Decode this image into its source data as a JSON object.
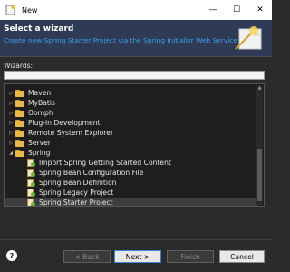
{
  "window": {
    "title": "New"
  },
  "header": {
    "title": "Select a wizard",
    "description": "Create new Spring Starter Project via the Spring Initializr Web Service"
  },
  "wizards_label": "Wizards:",
  "filter": {
    "value": ""
  },
  "tree": {
    "items": [
      {
        "label": "Maven",
        "type": "folder",
        "expanded": false
      },
      {
        "label": "MyBatis",
        "type": "folder",
        "expanded": false
      },
      {
        "label": "Oomph",
        "type": "folder",
        "expanded": false
      },
      {
        "label": "Plug-in Development",
        "type": "folder",
        "expanded": false
      },
      {
        "label": "Remote System Explorer",
        "type": "folder",
        "expanded": false
      },
      {
        "label": "Server",
        "type": "folder",
        "expanded": false
      },
      {
        "label": "Spring",
        "type": "folder",
        "expanded": true
      },
      {
        "label": "Import Spring Getting Started Content",
        "type": "leaf"
      },
      {
        "label": "Spring Bean Configuration File",
        "type": "leaf"
      },
      {
        "label": "Spring Bean Definition",
        "type": "leaf"
      },
      {
        "label": "Spring Legacy Project",
        "type": "leaf"
      },
      {
        "label": "Spring Starter Project",
        "type": "leaf",
        "selected": true
      }
    ]
  },
  "buttons": {
    "help": "?",
    "back": "< Back",
    "next": "Next >",
    "finish": "Finish",
    "cancel": "Cancel"
  },
  "icons": {
    "app": "new-wizard-icon",
    "minimize": "minimize-icon",
    "maximize": "maximize-icon",
    "close": "close-icon"
  },
  "colors": {
    "header_bg": "#2f3b54",
    "description": "#3aa0e8",
    "folder": "#e8b84a"
  }
}
